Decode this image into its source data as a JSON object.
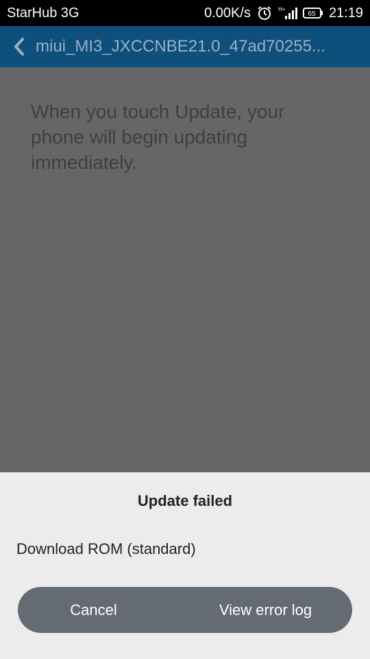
{
  "status_bar": {
    "carrier": "StarHub 3G",
    "net_speed": "0.00K/s",
    "battery": "65",
    "time": "21:19",
    "icons": [
      "alarm-clock-icon",
      "signal-h-plus-icon",
      "battery-icon"
    ]
  },
  "action_bar": {
    "back_icon": "chevron-left-icon",
    "title": "miui_MI3_JXCCNBE21.0_47ad70255..."
  },
  "content": {
    "message": "When you touch Update, your phone will begin updating immediately."
  },
  "dialog": {
    "title": "Update failed",
    "option": "Download ROM (standard)",
    "cancel_label": "Cancel",
    "view_log_label": "View error log"
  },
  "colors": {
    "action_bar_bg": "#0e4f7c",
    "dim_overlay": "#666666",
    "sheet_bg": "#ececec",
    "button_bar_bg": "#646b73"
  }
}
